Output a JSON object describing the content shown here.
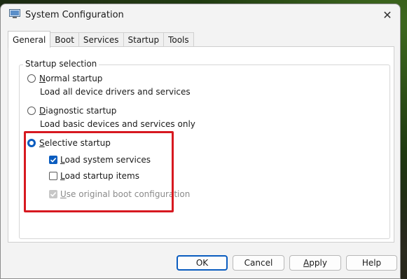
{
  "window": {
    "title": "System Configuration",
    "close_glyph": "✕",
    "icon": "system-config-icon"
  },
  "tabs": [
    {
      "label": "General",
      "active": true
    },
    {
      "label": "Boot",
      "active": false
    },
    {
      "label": "Services",
      "active": false
    },
    {
      "label": "Startup",
      "active": false
    },
    {
      "label": "Tools",
      "active": false
    }
  ],
  "startup_selection": {
    "group_label": "Startup selection",
    "normal": {
      "label_first": "N",
      "label_rest": "ormal startup",
      "description": "Load all device drivers and services",
      "selected": false
    },
    "diagnostic": {
      "label_first": "D",
      "label_rest": "iagnostic startup",
      "description": "Load basic devices and services only",
      "selected": false
    },
    "selective": {
      "label_first": "S",
      "label_rest": "elective startup",
      "selected": true,
      "options": {
        "load_system_services": {
          "label_first": "L",
          "label_rest": "oad system services",
          "checked": true,
          "enabled": true
        },
        "load_startup_items": {
          "label_first": "L",
          "label_rest": "oad startup items",
          "checked": false,
          "enabled": true
        },
        "use_original_boot": {
          "label_first": "U",
          "label_rest": "se original boot configuration",
          "checked": true,
          "enabled": false
        }
      }
    }
  },
  "buttons": {
    "ok": "OK",
    "cancel": "Cancel",
    "apply_first": "A",
    "apply_rest": "pply",
    "help": "Help"
  },
  "colors": {
    "accent": "#0a5cbf",
    "highlight_box": "#d71920"
  }
}
